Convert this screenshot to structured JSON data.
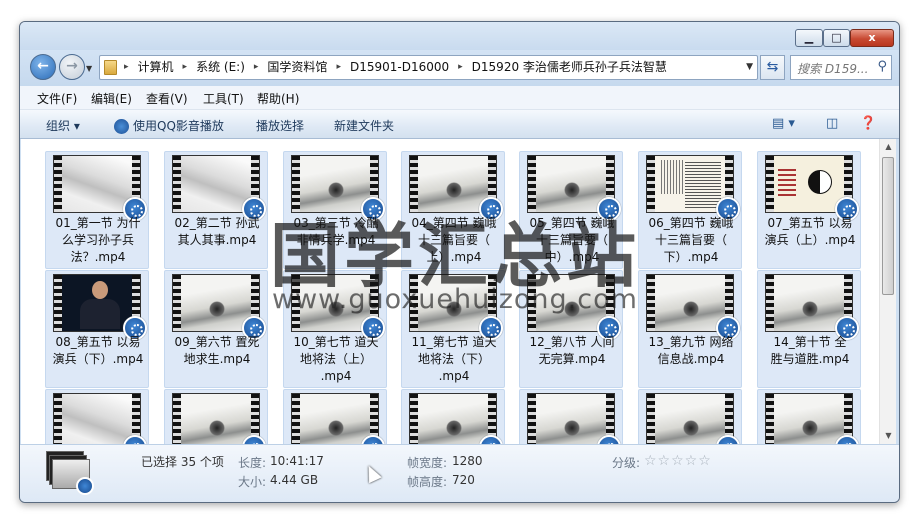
{
  "window": {
    "min_label": "▁",
    "max_label": "□",
    "close_label": "x"
  },
  "address": {
    "crumbs": [
      "计算机",
      "系统 (E:)",
      "国学资料馆",
      "D15901-D16000",
      "D15920 李治儒老师兵孙子兵法智慧"
    ],
    "search_placeholder": "搜索 D159..."
  },
  "menu": [
    "文件(F)",
    "编辑(E)",
    "查看(V)",
    "工具(T)",
    "帮助(H)"
  ],
  "toolbar": {
    "organize": "组织 ▾",
    "play_qq": "使用QQ影音播放",
    "play_select": "播放选择",
    "new_folder": "新建文件夹"
  },
  "files": [
    {
      "name": "01_第一节  为什么学习孙子兵法？.mp4",
      "lines": [
        "01_第一节  为什",
        "么学习孙子兵",
        "法？.mp4"
      ],
      "frame": "snow"
    },
    {
      "name": "02_第二节  孙武其人其事.mp4",
      "lines": [
        "02_第二节  孙武",
        "其人其事.mp4"
      ],
      "frame": "snow"
    },
    {
      "name": "03_第三节  冷酷非情兵学.mp4",
      "lines": [
        "03_第三节  冷酷",
        "非情兵学.mp4"
      ],
      "frame": "ink"
    },
    {
      "name": "04_第四节  巍峨十三篇旨要（上）.mp4",
      "lines": [
        "04_第四节  巍峨",
        "十三篇旨要（",
        "上）.mp4"
      ],
      "frame": "ink"
    },
    {
      "name": "05_第四节 巍峨十三篇旨要（中）.mp4",
      "lines": [
        "05_第四节 巍峨",
        "十三篇旨要（",
        "中）.mp4"
      ],
      "frame": "ink"
    },
    {
      "name": "06_第四节 巍峨十三篇旨要（下）.mp4",
      "lines": [
        "06_第四节 巍峨",
        "十三篇旨要（",
        "下）.mp4"
      ],
      "frame": "book"
    },
    {
      "name": "07_第五节  以易演兵（上）.mp4",
      "lines": [
        "07_第五节  以易",
        "演兵（上）.mp4"
      ],
      "frame": "yin"
    },
    {
      "name": "08_第五节  以易演兵（下）.mp4",
      "lines": [
        "08_第五节  以易",
        "演兵（下）.mp4"
      ],
      "frame": "person"
    },
    {
      "name": "09_第六节  置死地求生.mp4",
      "lines": [
        "09_第六节  置死",
        "地求生.mp4"
      ],
      "frame": "ink"
    },
    {
      "name": "10_第七节  道天地将法（上）.mp4",
      "lines": [
        "10_第七节  道天",
        "地将法（上）",
        ".mp4"
      ],
      "frame": "ink"
    },
    {
      "name": "11_第七节 道天地将法（下）.mp4",
      "lines": [
        "11_第七节 道天",
        "地将法（下）",
        ".mp4"
      ],
      "frame": "ink"
    },
    {
      "name": "12_第八节  人间无完算.mp4",
      "lines": [
        "12_第八节  人间",
        "无完算.mp4"
      ],
      "frame": "ink"
    },
    {
      "name": "13_第九节  网络信息战.mp4",
      "lines": [
        "13_第九节  网络",
        "信息战.mp4"
      ],
      "frame": "ink"
    },
    {
      "name": "14_第十节  全胜与道胜.mp4",
      "lines": [
        "14_第十节  全",
        "胜与道胜.mp4"
      ],
      "frame": "ink"
    },
    {
      "name": "",
      "lines": [],
      "frame": "snow"
    },
    {
      "name": "",
      "lines": [],
      "frame": "ink"
    },
    {
      "name": "",
      "lines": [],
      "frame": "ink"
    },
    {
      "name": "",
      "lines": [],
      "frame": "ink"
    },
    {
      "name": "",
      "lines": [],
      "frame": "ink"
    },
    {
      "name": "",
      "lines": [],
      "frame": "ink"
    },
    {
      "name": "",
      "lines": [],
      "frame": "ink"
    }
  ],
  "details": {
    "selected": "已选择 35 个项",
    "length_label": "长度:",
    "length_value": "10:41:17",
    "size_label": "大小:",
    "size_value": "4.44 GB",
    "width_label": "帧宽度:",
    "width_value": "1280",
    "height_label": "帧高度:",
    "height_value": "720",
    "rating_label": "分级:",
    "rating_stars": "☆☆☆☆☆"
  },
  "watermark": {
    "big": "国学汇总站",
    "url": "www.guoxuehuizong.com"
  }
}
